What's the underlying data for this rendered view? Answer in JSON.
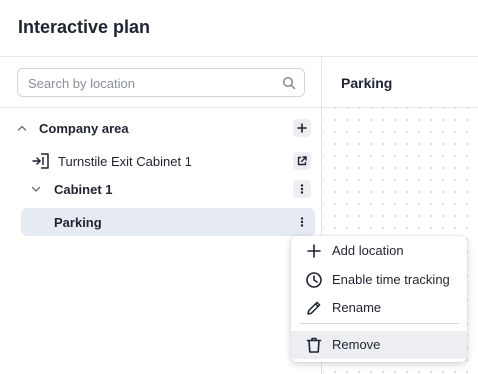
{
  "header": {
    "title": "Interactive plan"
  },
  "search": {
    "placeholder": "Search by location",
    "value": ""
  },
  "tree": {
    "company": {
      "label": "Company area",
      "add_icon": "plus-icon"
    },
    "turnstile": {
      "label": "Turnstile Exit Cabinet 1",
      "icon": "turnstile-exit-icon",
      "action_icon": "open-external-icon"
    },
    "cabinet": {
      "label": "Cabinet 1",
      "more_icon": "more-vertical-icon"
    },
    "parking": {
      "label": "Parking",
      "more_icon": "more-vertical-icon"
    }
  },
  "right": {
    "title": "Parking"
  },
  "context_menu": {
    "items": [
      {
        "label": "Add location",
        "icon": "plus-icon"
      },
      {
        "label": "Enable time tracking",
        "icon": "clock-icon"
      },
      {
        "label": "Rename",
        "icon": "pencil-icon"
      },
      {
        "label": "Remove",
        "icon": "trash-icon"
      }
    ]
  },
  "colors": {
    "selected_row": "#e5eaf3",
    "menu_hover": "#eceef2",
    "border": "#e3e5ea",
    "text": "#1f2430"
  }
}
